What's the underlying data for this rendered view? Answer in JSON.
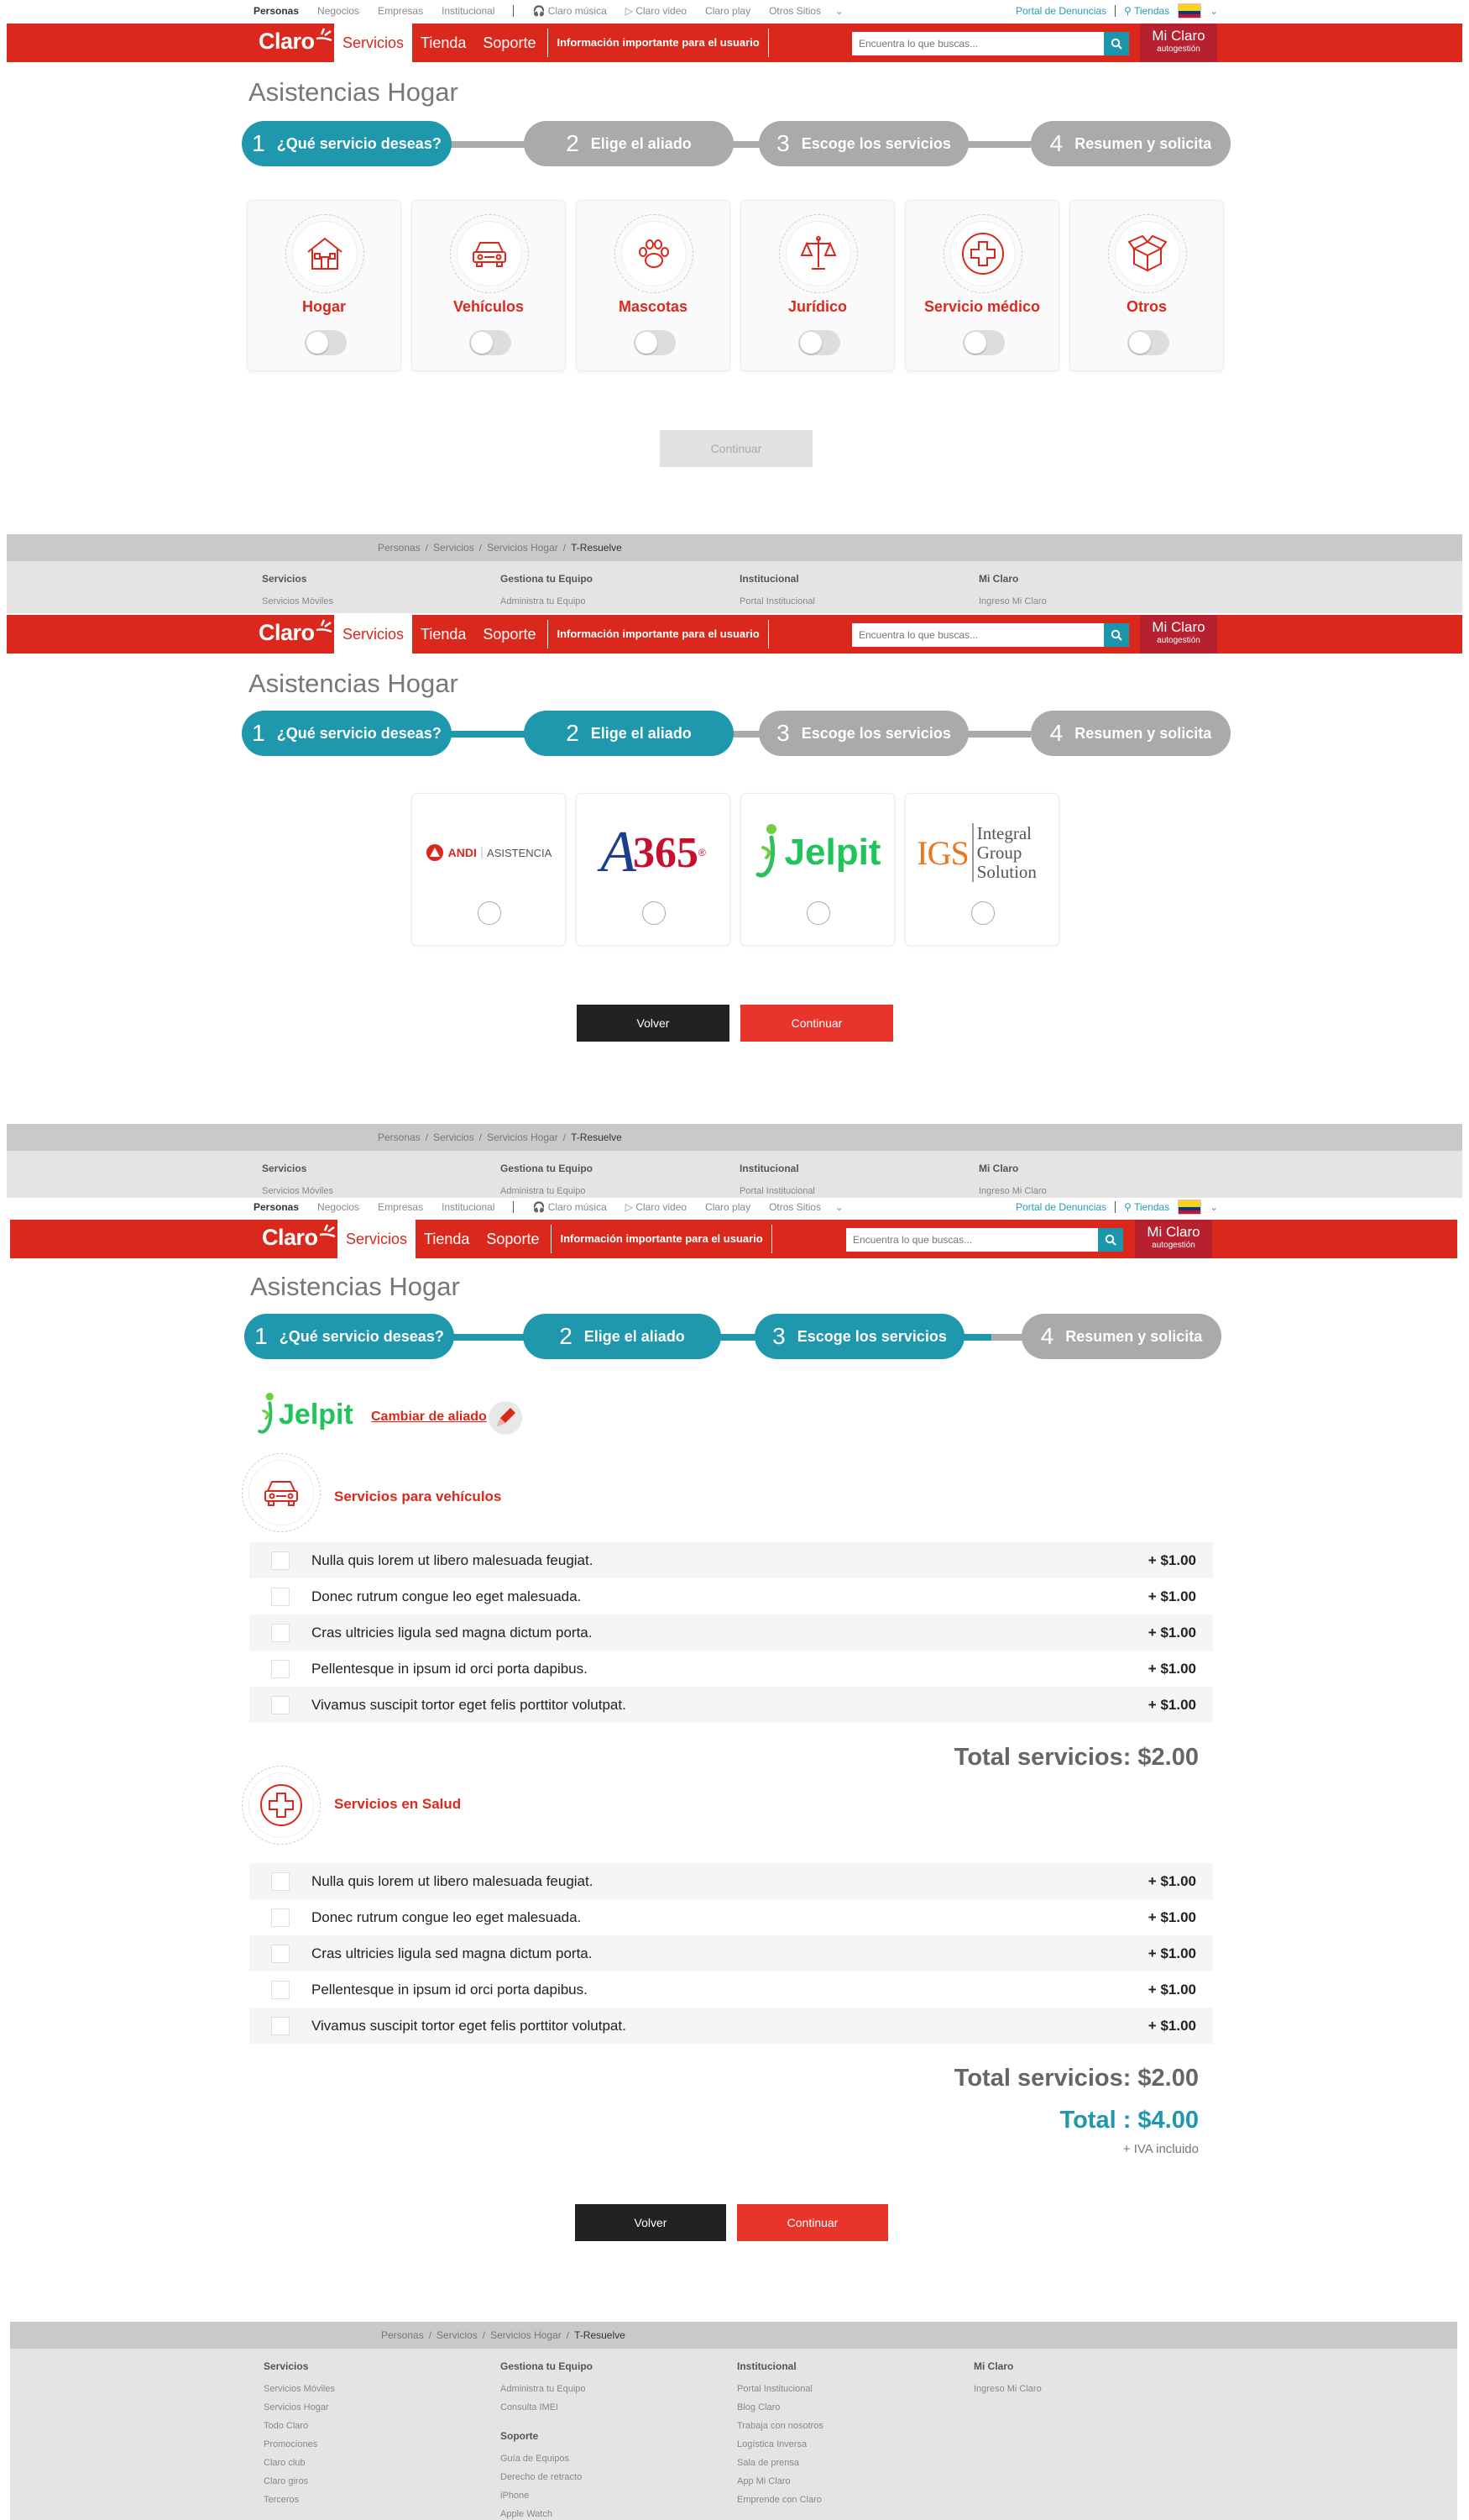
{
  "topbar": {
    "segments": [
      "Personas",
      "Negocios",
      "Empresas",
      "Institucional"
    ],
    "services": [
      "Claro música",
      "Claro video",
      "Claro play",
      "Otros Sitios"
    ],
    "complaints": "Portal de Denuncias",
    "stores": "Tiendas"
  },
  "header": {
    "logo": "Claro",
    "nav": [
      "Servicios",
      "Tienda",
      "Soporte"
    ],
    "info": "Información importante para el usuario",
    "search_placeholder": "Encuentra lo que buscas...",
    "miclaro_title": "Mi Claro",
    "miclaro_sub": "autogestión"
  },
  "page_title": "Asistencias Hogar",
  "steps": [
    {
      "num": "1",
      "label": "¿Qué servicio deseas?"
    },
    {
      "num": "2",
      "label": "Elige el aliado"
    },
    {
      "num": "3",
      "label": "Escoge los servicios"
    },
    {
      "num": "4",
      "label": "Resumen y solicita"
    }
  ],
  "services": [
    {
      "label": "Hogar",
      "icon": "house-icon"
    },
    {
      "label": "Vehículos",
      "icon": "car-icon"
    },
    {
      "label": "Mascotas",
      "icon": "paw-icon"
    },
    {
      "label": "Jurídico",
      "icon": "scales-icon"
    },
    {
      "label": "Servicio médico",
      "icon": "medical-cross-icon"
    },
    {
      "label": "Otros",
      "icon": "box-icon"
    }
  ],
  "buttons": {
    "continue": "Continuar",
    "back": "Volver"
  },
  "breadcrumb": [
    "Personas",
    "Servicios",
    "Servicios Hogar",
    "T-Resuelve"
  ],
  "footer": {
    "columns": [
      {
        "title": "Servicios",
        "links": [
          "Servicios Móviles",
          "Servicios Hogar",
          "Todo Claro",
          "Promociones",
          "Claro club",
          "Claro giros",
          "Terceros"
        ]
      },
      {
        "title": "Gestiona tu Equipo",
        "links": [
          "Administra tu Equipo",
          "Consulta IMEI"
        ]
      },
      {
        "title": "Institucional",
        "links": [
          "Portal Institucional",
          "Blog Claro",
          "Trabaja con nosotros",
          "Logística Inversa",
          "Sala de prensa",
          "App Mi Claro",
          "Emprende con Claro"
        ]
      },
      {
        "title": "Mi Claro",
        "links": [
          "Ingreso Mi Claro"
        ]
      }
    ],
    "support_title": "Soporte",
    "support_links": [
      "Guía de Equipos",
      "Derecho de retracto",
      "iPhone",
      "Apple Watch"
    ]
  },
  "allies": [
    {
      "name": "ANDI",
      "tag": "ASISTENCIA"
    },
    {
      "name": "A365",
      "tag": "®"
    },
    {
      "name": "Jelpit",
      "tag": ""
    },
    {
      "name": "IGS",
      "tag": "Integral Group Solution"
    }
  ],
  "step3": {
    "selected_ally": "Jelpit",
    "change_ally": "Cambiar de aliado",
    "sections": [
      {
        "title": "Servicios para vehículos",
        "icon": "car-icon",
        "items": [
          {
            "text": "Nulla quis lorem ut libero malesuada feugiat.",
            "price": "+ $1.00"
          },
          {
            "text": "Donec rutrum congue leo eget malesuada.",
            "price": "+ $1.00"
          },
          {
            "text": "Cras ultricies ligula sed magna dictum porta.",
            "price": "+ $1.00"
          },
          {
            "text": "Pellentesque in ipsum id orci porta dapibus.",
            "price": "+ $1.00"
          },
          {
            "text": "Vivamus suscipit tortor eget felis porttitor volutpat.",
            "price": "+ $1.00"
          }
        ],
        "subtotal": "Total servicios: $2.00"
      },
      {
        "title": "Servicios en Salud",
        "icon": "medical-cross-icon",
        "items": [
          {
            "text": "Nulla quis lorem ut libero malesuada feugiat.",
            "price": "+ $1.00"
          },
          {
            "text": "Donec rutrum congue leo eget malesuada.",
            "price": "+ $1.00"
          },
          {
            "text": "Cras ultricies ligula sed magna dictum porta.",
            "price": "+ $1.00"
          },
          {
            "text": "Pellentesque in ipsum id orci porta dapibus.",
            "price": "+ $1.00"
          },
          {
            "text": "Vivamus suscipit tortor eget felis porttitor volutpat.",
            "price": "+ $1.00"
          }
        ],
        "subtotal": "Total servicios: $2.00"
      }
    ],
    "total": "Total : $4.00",
    "iva": "+ IVA incluido"
  },
  "colors": {
    "brand_red": "#da291c",
    "teal": "#1f97ad",
    "step_off": "#aaaaaa"
  }
}
